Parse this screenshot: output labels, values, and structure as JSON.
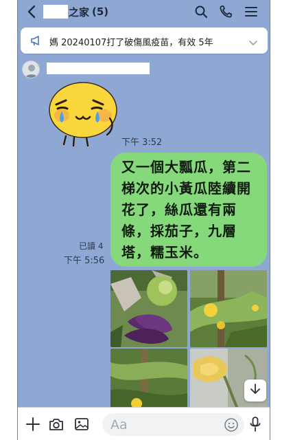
{
  "header": {
    "title_suffix": "之家",
    "member_count": "(5)",
    "back_icon": "back-chevron-icon",
    "search_icon": "search-icon",
    "call_icon": "phone-icon",
    "menu_icon": "hamburger-menu-icon"
  },
  "announcement": {
    "icon": "megaphone-icon",
    "text": "媽 20240107打了破傷風疫苗，有效 5年",
    "expand_icon": "chevron-down-icon"
  },
  "messages": [
    {
      "type": "sticker",
      "sticker_name": "crying-yellow-face-sticker",
      "time": "下午 3:52"
    },
    {
      "type": "text",
      "text": "又一個大瓢瓜，第二梯次的小黃瓜陸續開花了，絲瓜還有兩條，採茄子，九層塔，糯玉米。",
      "read_status": "已讀 4",
      "time": "下午 5:56"
    },
    {
      "type": "photo-grid",
      "photos": [
        "eggplant-and-gourd-photo",
        "cucumber-flower-photo",
        "garden-stake-photo",
        "flower-closeup-photo"
      ]
    }
  ],
  "toolbar": {
    "add_icon": "plus-icon",
    "camera_icon": "camera-icon",
    "gallery_icon": "image-icon",
    "input_placeholder": "Aa",
    "emoji_icon": "emoji-icon",
    "mic_icon": "microphone-icon"
  },
  "scroll_down_icon": "arrow-down-icon",
  "colors": {
    "chat_background": "#8fa8d3",
    "bubble": "#86d97a",
    "announcement_bg": "#ffffff",
    "accent": "#4a74c9"
  }
}
